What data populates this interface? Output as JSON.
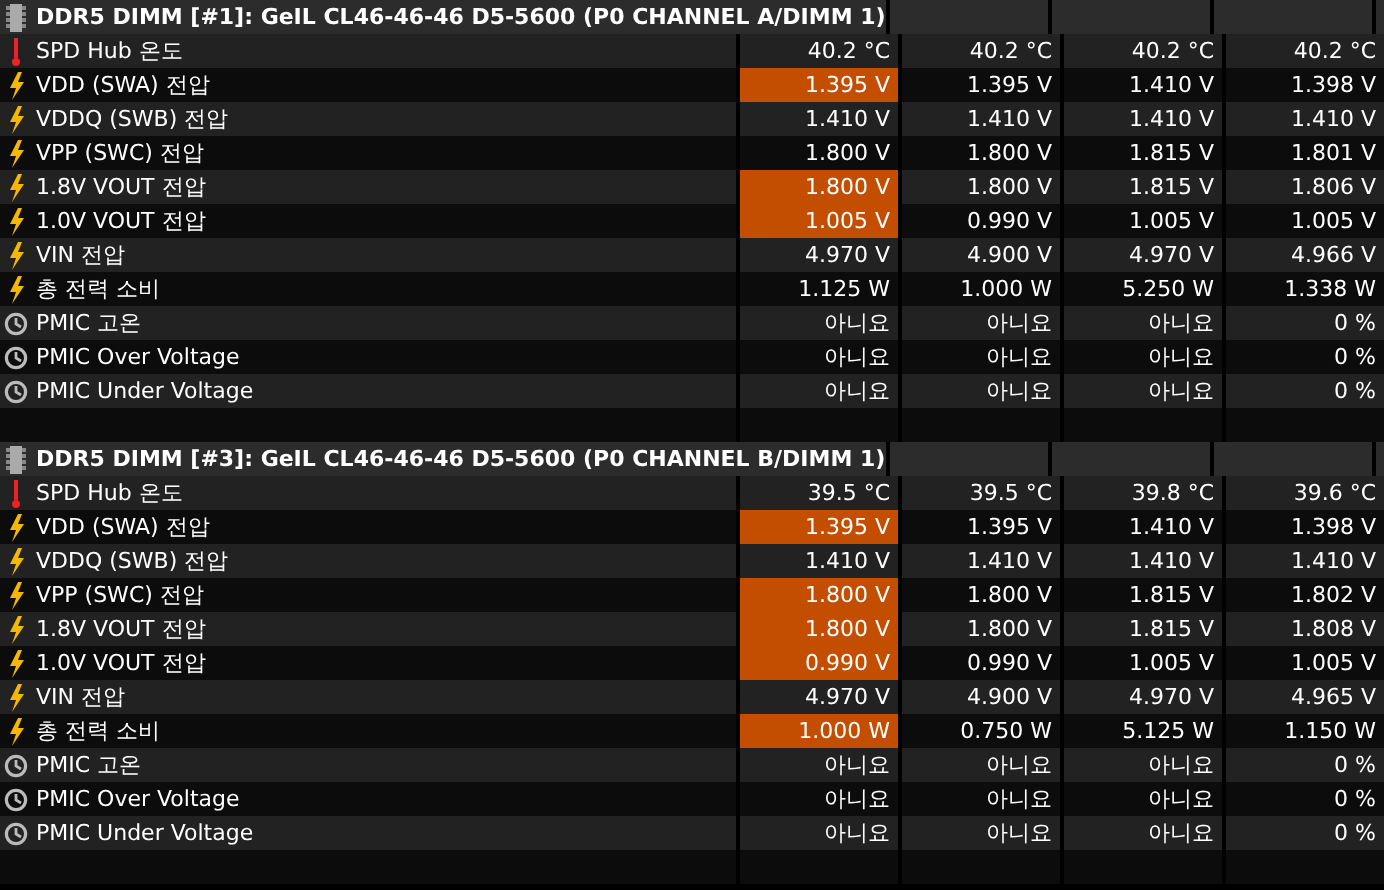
{
  "sections": [
    {
      "title": "DDR5 DIMM [#1]: GeIL CL46-46-46 D5-5600 (P0 CHANNEL A/DIMM 1)",
      "rows": [
        {
          "kind": "temperature",
          "label": "SPD Hub 온도",
          "alert": false,
          "values": [
            "40.2 °C",
            "40.2 °C",
            "40.2 °C",
            "40.2 °C"
          ]
        },
        {
          "kind": "power",
          "label": "VDD (SWA) 전압",
          "alert": true,
          "values": [
            "1.395 V",
            "1.395 V",
            "1.410 V",
            "1.398 V"
          ]
        },
        {
          "kind": "power",
          "label": "VDDQ (SWB) 전압",
          "alert": false,
          "values": [
            "1.410 V",
            "1.410 V",
            "1.410 V",
            "1.410 V"
          ]
        },
        {
          "kind": "power",
          "label": "VPP (SWC) 전압",
          "alert": false,
          "values": [
            "1.800 V",
            "1.800 V",
            "1.815 V",
            "1.801 V"
          ]
        },
        {
          "kind": "power",
          "label": "1.8V VOUT 전압",
          "alert": true,
          "values": [
            "1.800 V",
            "1.800 V",
            "1.815 V",
            "1.806 V"
          ]
        },
        {
          "kind": "power",
          "label": "1.0V VOUT 전압",
          "alert": true,
          "values": [
            "1.005 V",
            "0.990 V",
            "1.005 V",
            "1.005 V"
          ]
        },
        {
          "kind": "power",
          "label": "VIN 전압",
          "alert": false,
          "values": [
            "4.970 V",
            "4.900 V",
            "4.970 V",
            "4.966 V"
          ]
        },
        {
          "kind": "power",
          "label": "총 전력 소비",
          "alert": false,
          "values": [
            "1.125 W",
            "1.000 W",
            "5.250 W",
            "1.338 W"
          ]
        },
        {
          "kind": "status",
          "label": "PMIC 고온",
          "alert": false,
          "values": [
            "아니요",
            "아니요",
            "아니요",
            "0 %"
          ]
        },
        {
          "kind": "status",
          "label": "PMIC Over Voltage",
          "alert": false,
          "values": [
            "아니요",
            "아니요",
            "아니요",
            "0 %"
          ]
        },
        {
          "kind": "status",
          "label": "PMIC Under Voltage",
          "alert": false,
          "values": [
            "아니요",
            "아니요",
            "아니요",
            "0 %"
          ]
        }
      ]
    },
    {
      "title": "DDR5 DIMM [#3]: GeIL CL46-46-46 D5-5600 (P0 CHANNEL B/DIMM 1)",
      "rows": [
        {
          "kind": "temperature",
          "label": "SPD Hub 온도",
          "alert": false,
          "values": [
            "39.5 °C",
            "39.5 °C",
            "39.8 °C",
            "39.6 °C"
          ]
        },
        {
          "kind": "power",
          "label": "VDD (SWA) 전압",
          "alert": true,
          "values": [
            "1.395 V",
            "1.395 V",
            "1.410 V",
            "1.398 V"
          ]
        },
        {
          "kind": "power",
          "label": "VDDQ (SWB) 전압",
          "alert": false,
          "values": [
            "1.410 V",
            "1.410 V",
            "1.410 V",
            "1.410 V"
          ]
        },
        {
          "kind": "power",
          "label": "VPP (SWC) 전압",
          "alert": true,
          "values": [
            "1.800 V",
            "1.800 V",
            "1.815 V",
            "1.802 V"
          ]
        },
        {
          "kind": "power",
          "label": "1.8V VOUT 전압",
          "alert": true,
          "values": [
            "1.800 V",
            "1.800 V",
            "1.815 V",
            "1.808 V"
          ]
        },
        {
          "kind": "power",
          "label": "1.0V VOUT 전압",
          "alert": true,
          "values": [
            "0.990 V",
            "0.990 V",
            "1.005 V",
            "1.005 V"
          ]
        },
        {
          "kind": "power",
          "label": "VIN 전압",
          "alert": false,
          "values": [
            "4.970 V",
            "4.900 V",
            "4.970 V",
            "4.965 V"
          ]
        },
        {
          "kind": "power",
          "label": "총 전력 소비",
          "alert": true,
          "values": [
            "1.000 W",
            "0.750 W",
            "5.125 W",
            "1.150 W"
          ]
        },
        {
          "kind": "status",
          "label": "PMIC 고온",
          "alert": false,
          "values": [
            "아니요",
            "아니요",
            "아니요",
            "0 %"
          ]
        },
        {
          "kind": "status",
          "label": "PMIC Over Voltage",
          "alert": false,
          "values": [
            "아니요",
            "아니요",
            "아니요",
            "0 %"
          ]
        },
        {
          "kind": "status",
          "label": "PMIC Under Voltage",
          "alert": false,
          "values": [
            "아니요",
            "아니요",
            "아니요",
            "0 %"
          ]
        }
      ]
    }
  ]
}
